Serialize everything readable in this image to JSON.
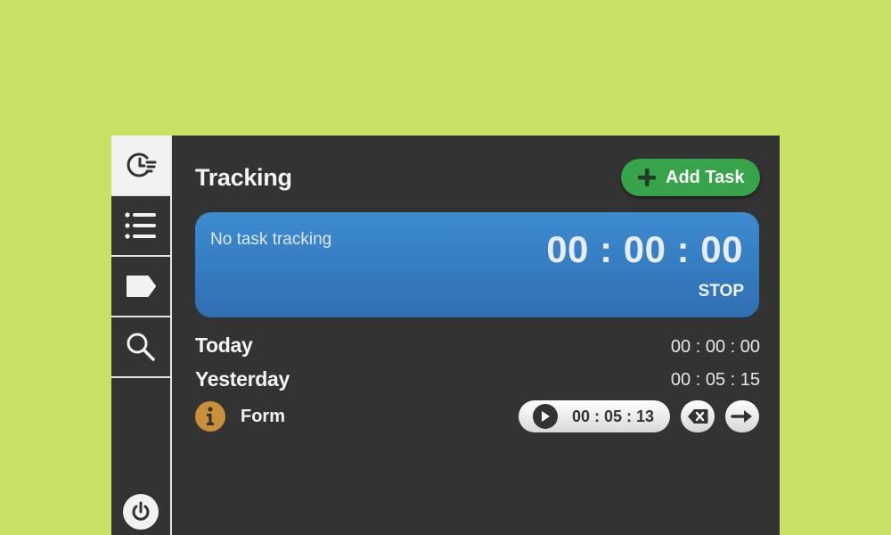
{
  "sidebar": {
    "items": [
      {
        "icon": "clock-list-icon",
        "active": true
      },
      {
        "icon": "list-icon",
        "active": false
      },
      {
        "icon": "tag-icon",
        "active": false
      },
      {
        "icon": "search-icon",
        "active": false
      }
    ],
    "power_icon": "power-icon"
  },
  "header": {
    "title": "Tracking",
    "add_task_label": "Add Task"
  },
  "tracker": {
    "status": "No task tracking",
    "timer": "00 : 00 : 00",
    "stop_label": "STOP"
  },
  "summary": {
    "today_label": "Today",
    "today_time": "00 : 00 : 00",
    "yesterday_label": "Yesterday",
    "yesterday_time": "00 : 05 : 15"
  },
  "task": {
    "name": "Form",
    "time": "00 : 05 : 13"
  },
  "colors": {
    "background": "#c8e265",
    "panel": "#333333",
    "accent_green": "#37a34a",
    "tracker_blue": "#3a82c9",
    "info_orange": "#c98f3a"
  }
}
